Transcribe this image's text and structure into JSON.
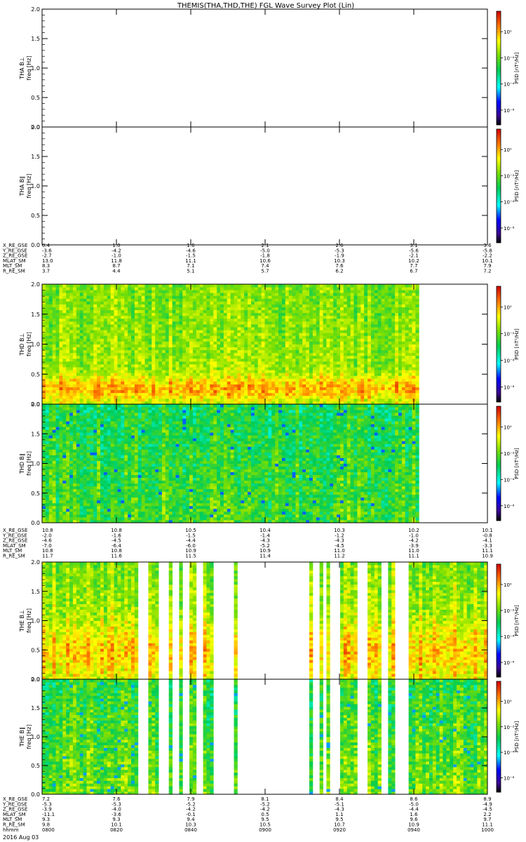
{
  "title": "THEMIS(THA,THD,THE) FGL Wave Survey Plot (Lin)",
  "date_label": "2016 Aug 03",
  "colors": {
    "axis": "#000000",
    "background": "#ffffff"
  },
  "colorbar_ticks": [
    "10⁰",
    "10⁻²",
    "10⁻⁴",
    "10⁻⁶"
  ],
  "colorbar_label": "PSD [nT²/Hz]",
  "chart_data": [
    {
      "type": "heatmap",
      "title": "",
      "probe": "THA",
      "ylabel": "THA B⊥ freq [Hz]",
      "ylim": [
        0,
        2
      ],
      "yticks": [
        "0.0",
        "0.5",
        "1.0",
        "1.5",
        "2.0"
      ],
      "data_extent": [],
      "colorscale": "rainbow"
    },
    {
      "type": "heatmap",
      "title": "",
      "probe": "THA",
      "ylabel": "THA B∥ freq [Hz]",
      "ylim": [
        0,
        2
      ],
      "yticks": [
        "0.0",
        "0.5",
        "1.0",
        "1.5",
        "2.0"
      ],
      "data_extent": [],
      "colorscale": "rainbow"
    },
    {
      "type": "heatmap",
      "title": "",
      "probe": "THD",
      "ylabel": "THD B⊥ freq [Hz]",
      "ylim": [
        0,
        2
      ],
      "yticks": [
        "0.0",
        "0.5",
        "1.0",
        "1.5",
        "2.0"
      ],
      "data_extent": [
        [
          0,
          0.848
        ]
      ],
      "colorscale": "rainbow",
      "mean_level": "yellow-orange, strong 0.1–0.4 Hz"
    },
    {
      "type": "heatmap",
      "title": "",
      "probe": "THD",
      "ylabel": "THD B∥ freq [Hz]",
      "ylim": [
        0,
        2
      ],
      "yticks": [
        "0.0",
        "0.5",
        "1.0",
        "1.5",
        "2.0"
      ],
      "data_extent": [
        [
          0,
          0.848
        ]
      ],
      "colorscale": "rainbow",
      "mean_level": "green-cyan"
    },
    {
      "type": "heatmap",
      "title": "",
      "probe": "THE",
      "ylabel": "THE B⊥ freq [Hz]",
      "ylim": [
        0,
        2
      ],
      "yticks": [
        "0.0",
        "0.5",
        "1.0",
        "1.5",
        "2.0"
      ],
      "data_extent": [
        [
          0,
          0.216
        ],
        [
          0.24,
          0.265
        ],
        [
          0.285,
          0.295
        ],
        [
          0.306,
          0.31
        ],
        [
          0.33,
          0.348
        ],
        [
          0.365,
          0.385
        ],
        [
          0.43,
          0.432
        ],
        [
          0.6,
          0.603
        ],
        [
          0.625,
          0.628
        ],
        [
          0.64,
          0.643
        ],
        [
          0.67,
          0.71
        ],
        [
          0.728,
          0.758
        ],
        [
          0.78,
          0.795
        ],
        [
          0.82,
          1.0
        ]
      ],
      "colorscale": "rainbow",
      "mean_level": "orange-red 0–1 Hz"
    },
    {
      "type": "heatmap",
      "title": "",
      "probe": "THE",
      "ylabel": "THE B∥ freq [Hz]",
      "ylim": [
        0,
        2
      ],
      "yticks": [
        "0.0",
        "0.5",
        "1.0",
        "1.5",
        "2.0"
      ],
      "data_extent": [
        [
          0,
          0.216
        ],
        [
          0.24,
          0.265
        ],
        [
          0.285,
          0.295
        ],
        [
          0.306,
          0.31
        ],
        [
          0.33,
          0.348
        ],
        [
          0.365,
          0.385
        ],
        [
          0.43,
          0.432
        ],
        [
          0.6,
          0.603
        ],
        [
          0.625,
          0.628
        ],
        [
          0.64,
          0.643
        ],
        [
          0.67,
          0.71
        ],
        [
          0.728,
          0.758
        ],
        [
          0.78,
          0.795
        ],
        [
          0.82,
          1.0
        ]
      ],
      "colorscale": "rainbow",
      "mean_level": "green"
    }
  ],
  "ephemeris": [
    {
      "probe": "THA",
      "labels": [
        "X_RE_GSE",
        "Y_RE_GSE",
        "Z_RE_GSE",
        "MLAT_SM",
        "MLT_SM",
        "R_RE_SM"
      ],
      "columns": [
        [
          "0.4",
          "-3.6",
          "-2.7",
          "13.0",
          "8.3",
          "3.7"
        ],
        [
          "1.0",
          "-4.2",
          "-1.0",
          "11.8",
          "8.7",
          "4.4"
        ],
        [
          "1.6",
          "-4.6",
          "-1.5",
          "11.1",
          "7.1",
          "5.1"
        ],
        [
          "2.1",
          "-5.0",
          "-1.8",
          "10.6",
          "7.4",
          "5.7"
        ],
        [
          "2.6",
          "-5.3",
          "-1.9",
          "10.3",
          "7.6",
          "6.2"
        ],
        [
          "3.1",
          "-5.6",
          "-2.1",
          "10.2",
          "7.7",
          "6.7"
        ],
        [
          "3.6",
          "-5.8",
          "-2.2",
          "10.1",
          "7.9",
          "7.2"
        ]
      ]
    },
    {
      "probe": "THD",
      "labels": [
        "X_RE_GSE",
        "Y_RE_GSE",
        "Z_RE_GSE",
        "MLAT_SM",
        "MLT_SM",
        "R_RE_SM"
      ],
      "columns": [
        [
          "10.8",
          "-2.0",
          "-4.6",
          "-7.0",
          "10.8",
          "11.7"
        ],
        [
          "10.8",
          "-1.6",
          "-4.5",
          "-6.4",
          "10.8",
          "11.6"
        ],
        [
          "10.5",
          "-1.5",
          "-4.4",
          "-6.0",
          "10.9",
          "11.5"
        ],
        [
          "10.4",
          "-1.4",
          "-4.3",
          "-5.2",
          "10.9",
          "11.4"
        ],
        [
          "10.3",
          "-1.2",
          "-4.3",
          "-4.5",
          "11.0",
          "11.2"
        ],
        [
          "10.2",
          "-1.0",
          "-4.2",
          "-3.9",
          "11.0",
          "11.1"
        ],
        [
          "10.1",
          "-0.8",
          "-4.1",
          "-3.3",
          "11.1",
          "10.9"
        ]
      ]
    },
    {
      "probe": "THE",
      "labels": [
        "X_RE_GSE",
        "Y_RE_GSE",
        "Z_RE_GSE",
        "MLAT_SM",
        "MLT_SM",
        "R_RE_SM",
        "hhmm"
      ],
      "columns": [
        [
          "7.2",
          "-5.3",
          "-3.9",
          "-11.1",
          "9.3",
          "9.8",
          "0800"
        ],
        [
          "7.6",
          "-5.3",
          "-4.0",
          "-3.6",
          "9.3",
          "10.1",
          "0820"
        ],
        [
          "7.9",
          "-5.2",
          "-4.2",
          "-0.1",
          "9.4",
          "10.3",
          "0840"
        ],
        [
          "8.1",
          "-5.2",
          "-4.2",
          "0.5",
          "9.5",
          "10.5",
          "0900"
        ],
        [
          "8.4",
          "-5.1",
          "-4.3",
          "1.1",
          "9.5",
          "10.7",
          "0920"
        ],
        [
          "8.6",
          "-5.0",
          "-4.4",
          "1.6",
          "9.6",
          "10.9",
          "0940"
        ],
        [
          "8.9",
          "-4.9",
          "-4.5",
          "2.2",
          "9.7",
          "11.1",
          "1000"
        ]
      ]
    }
  ]
}
